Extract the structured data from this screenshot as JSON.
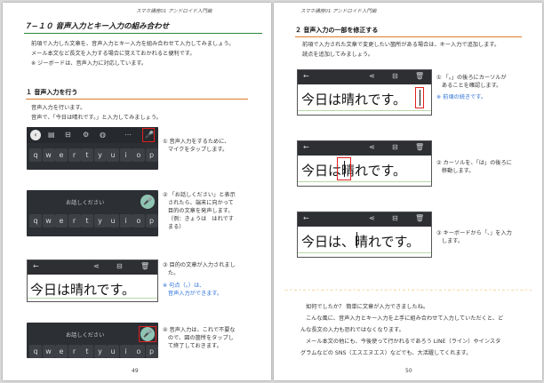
{
  "left_page": {
    "running_header": "スマホ講座01 アンドロイド入門編",
    "title": "７−１０ 音声入力とキー入力の組み合わせ",
    "intro": [
      "前項で入力した文章を、音声入力とキー入力を組み合わせて入力してみましょう。",
      "メール本文など長文を入力する場合に覚えておかれると便利です。",
      "※ ジーボードは、音声入力に対応しています。"
    ],
    "section1": {
      "heading": "１ 音声入力を行う",
      "lines": [
        "音声入力を行います。",
        "音声で、「今日は晴れです。」と入力してみましょう。"
      ]
    },
    "kb_row_keys": [
      "q",
      "w",
      "e",
      "r",
      "t",
      "y",
      "u",
      "i",
      "o",
      "p"
    ],
    "listening_label": "お話しください",
    "screen_text": "今日は晴れです。",
    "steps": [
      {
        "num": "①",
        "lines": [
          "音声入力をするために、",
          "マイクをタップします。"
        ]
      },
      {
        "num": "②",
        "lines": [
          "「お話しください」と表示",
          "されたら、端末に向かって",
          "目的の文章を発声します。",
          "（例：きょうは　はれです",
          "まる）"
        ]
      },
      {
        "num": "③",
        "lines": [
          "目的の文章が入力されまし",
          "た。"
        ],
        "note": [
          "※ 句点（。）は、",
          "音声入力ができます。"
        ]
      },
      {
        "num": "④",
        "lines": [
          "音声入力は、これで不要な",
          "ので、図の箇所をタップし",
          "て終了しておきます。"
        ]
      }
    ],
    "page_number": "49"
  },
  "right_page": {
    "running_header": "スマホ講座01 アンドロイド入門編",
    "section2": {
      "heading": "２ 音声入力の一部を修正する",
      "lines": [
        "前項で入力された文章で変更したい箇所がある場合は、キー入力で追加します。",
        "読点を追加してみましょう。"
      ]
    },
    "screens": [
      {
        "text": "今日は晴れです。"
      },
      {
        "text": "今日は晴れです。"
      },
      {
        "text": "今日は、晴れです。"
      }
    ],
    "steps": [
      {
        "num": "①",
        "lines": [
          "「。」の後ろにカーソルが",
          "あることを確認します。"
        ],
        "note": [
          "※ 前頃の続きです。"
        ]
      },
      {
        "num": "②",
        "lines": [
          "カーソルを、「は」の後ろに",
          "移動します。"
        ]
      },
      {
        "num": "③",
        "lines": [
          "キーボードから「、」を入力",
          "します。"
        ]
      }
    ],
    "closing": [
      "如何でしたか？ 簡単に文章が入力できましたね。",
      "こんな風に、音声入力とキー入力を上手に組み合わせて入力していただくと、ど",
      "んな長文の入力も恐れではなくなります。",
      "メール本文の他にも、今後使って行かれるであろう LINE（ライン）やインスタ",
      "グラムなどの SNS（エスエヌエス）などでも、大活躍してくれます。"
    ],
    "page_number": "50"
  },
  "icons": [
    "back-arrow-icon",
    "share-icon",
    "save-icon",
    "trash-icon",
    "mic-icon",
    "settings-icon",
    "emoji-icon",
    "palette-icon",
    "more-icon",
    "sticker-icon"
  ],
  "colors": {
    "title_rule": "#2a8a3a",
    "section_rule": "#e07a2a",
    "highlight_box": "#e02020",
    "note_blue": "#2a6fd8",
    "keyboard_bg": "#2c2f33",
    "mic_active": "#8fc4b2"
  }
}
